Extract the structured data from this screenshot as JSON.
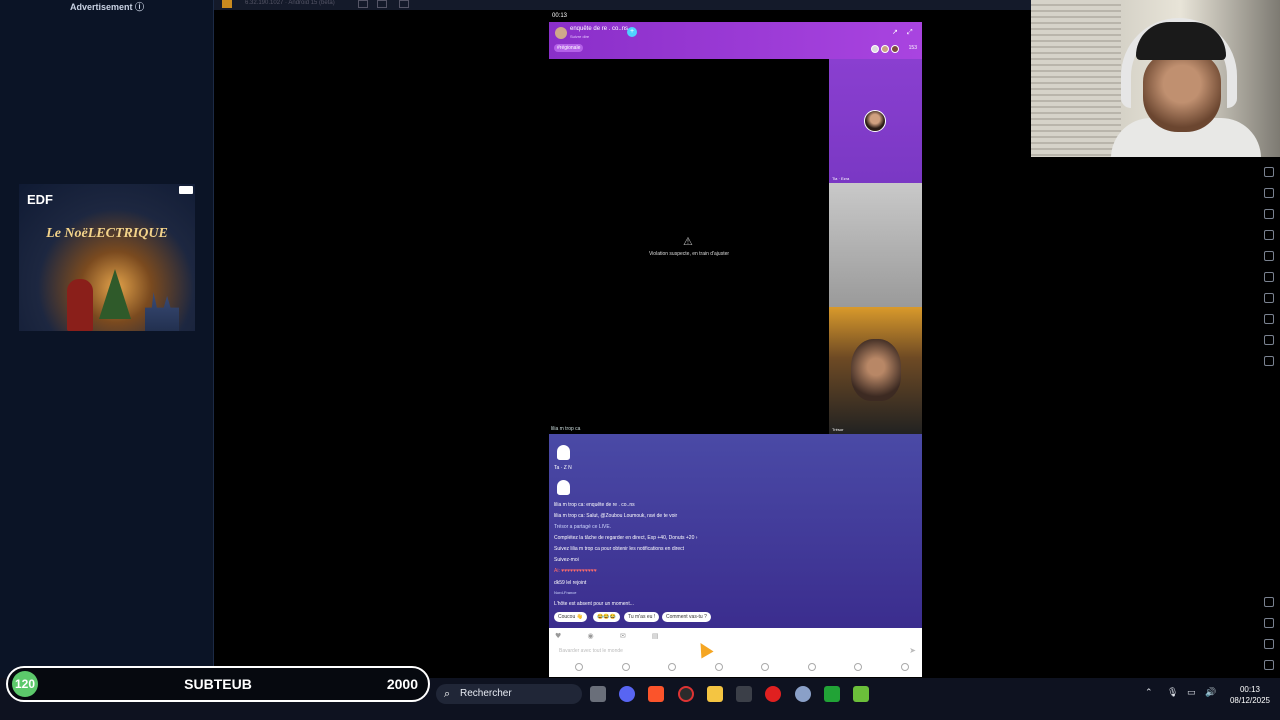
{
  "ad": {
    "label": "Advertisement",
    "info_icon": "info-icon",
    "brand": "EDF",
    "headline": "Le NoëLECTRIQUE"
  },
  "topbar": {
    "version": "6.32.190.1027 · Android 15 (beta)"
  },
  "stream": {
    "time": "00:13",
    "host_name": "enquête de re . co..ns",
    "host_sub": "Suivre dire",
    "tag": "#régionale",
    "viewers": "153",
    "violation_msg": "Violation suspecte, en train d'ajuster",
    "host_label": "lilia m trop ca",
    "guest1_label": "Tia · Ezra",
    "guest3_label": "Trésor"
  },
  "chat": {
    "lines": [
      "Ta  ·  Z  N",
      "lilia m trop ca: enquête de re . co..ns",
      "lilia m trop ca: Salut, @Zoubou Loumouk, ravi de te voir",
      "Trésor a partagé ce LIVE.",
      "Complétez la tâche de regarder en direct, Exp +40, Donuts +20 ›",
      "Suivez lilia m trop ca pour obtenir les notifications en direct",
      "Suivez-moi",
      "Ai: ♥♥♥♥♥♥♥♥♥♥♥♥",
      "dk59 lel rejoint",
      "Nord-France",
      "L'hôte est absent pour un moment..."
    ],
    "quick_replies": [
      "Coucou 👋",
      "😂😂😂",
      "Tu m'as eu !",
      "Comment vas-tu ?"
    ],
    "input_placeholder": "Bavarder avec tout le monde"
  },
  "taskbar": {
    "search_label": "Rechercher",
    "time": "00:13",
    "date": "08/12/2025"
  },
  "overlay": {
    "count": "120",
    "label": "SUBTEUB",
    "goal": "2000"
  }
}
